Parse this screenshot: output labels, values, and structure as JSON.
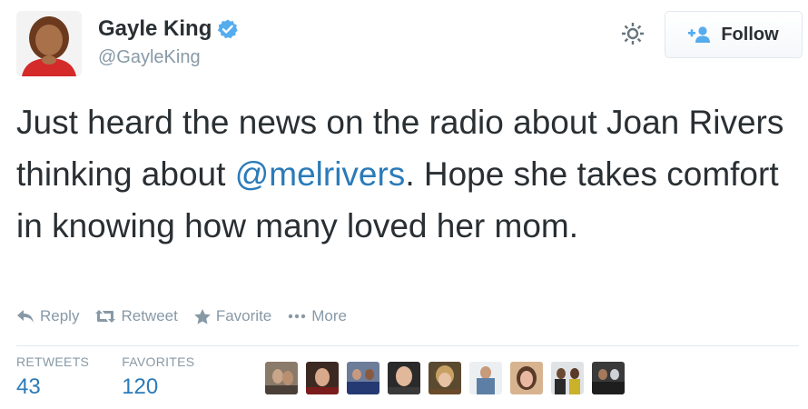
{
  "user": {
    "name": "Gayle King",
    "handle": "@GayleKing",
    "verified_icon": "verified-badge-icon",
    "avatar": "profile-photo"
  },
  "header": {
    "settings_icon": "gear-icon",
    "follow_label": "Follow",
    "follow_icon": "add-user-icon"
  },
  "tweet": {
    "text_part1": "Just heard the news on the radio about Joan Rivers thinking about ",
    "mention": "@melrivers",
    "text_part2": ". Hope she takes comfort in knowing how many loved her mom."
  },
  "actions": {
    "reply": "Reply",
    "retweet": "Retweet",
    "favorite": "Favorite",
    "more": "More"
  },
  "stats": {
    "retweets_label": "RETWEETS",
    "retweets_value": "43",
    "favorites_label": "FAVORITES",
    "favorites_value": "120"
  },
  "favoriters": [
    "avatar-1",
    "avatar-2",
    "avatar-3",
    "avatar-4",
    "avatar-5",
    "avatar-6",
    "avatar-7",
    "avatar-8",
    "avatar-9"
  ],
  "colors": {
    "link": "#2b7bb9",
    "verified": "#55acee",
    "muted": "#8899a6",
    "text": "#292f33"
  }
}
